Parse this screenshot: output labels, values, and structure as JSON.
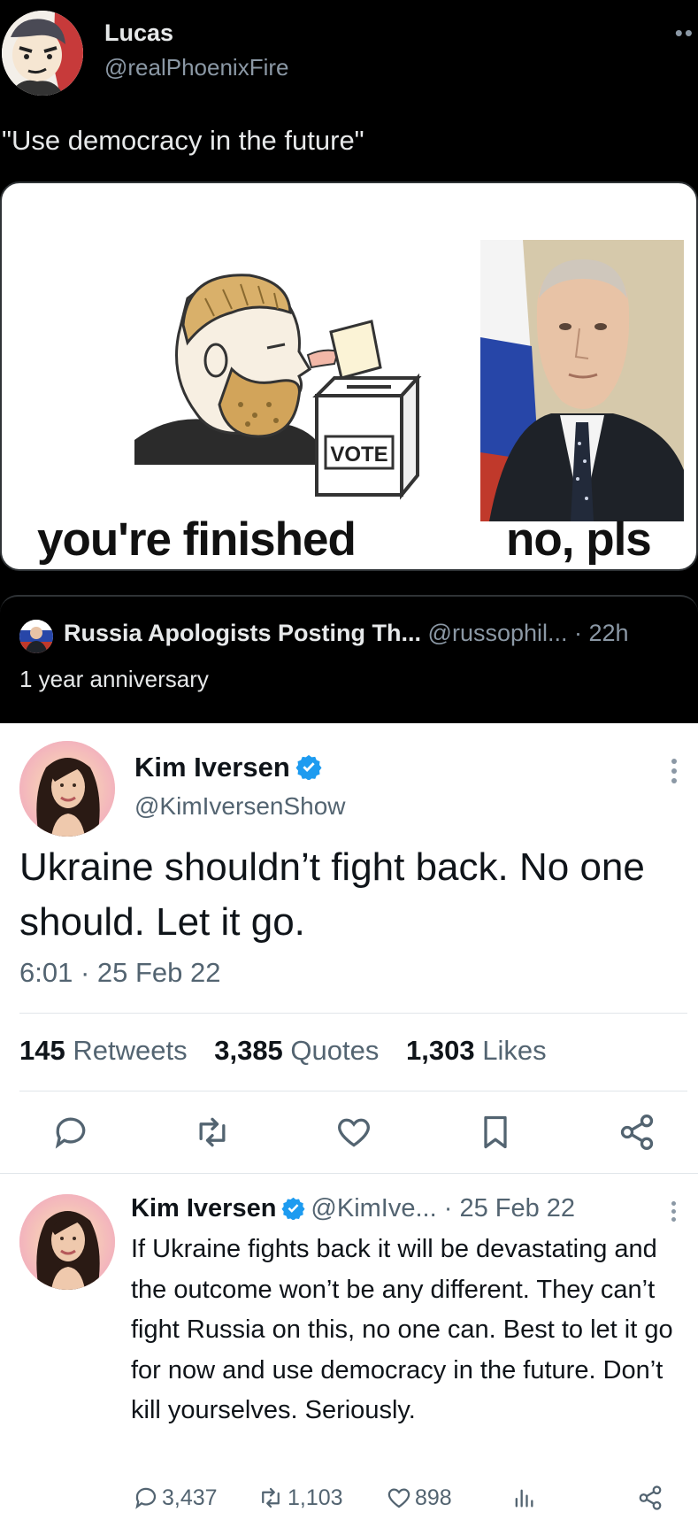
{
  "top_tweet": {
    "name": "Lucas",
    "handle": "@realPhoenixFire",
    "more": "••",
    "text": "\"Use democracy in the future\"",
    "meme": {
      "ballot_label": "VOTE",
      "caption_left": "you're finished",
      "caption_right": "no, pls"
    }
  },
  "quoted": {
    "name": "Russia Apologists Posting Th...",
    "handle": "@russophil...",
    "time": "· 22h",
    "text": "1 year anniversary"
  },
  "tweet1": {
    "name": "Kim Iversen",
    "handle": "@KimIversenShow",
    "text": "Ukraine shouldn’t fight back. No one should. Let it go.",
    "time": "6:01 · 25 Feb 22",
    "retweets_count": "145",
    "retweets_label": "Retweets",
    "quotes_count": "3,385",
    "quotes_label": "Quotes",
    "likes_count": "1,303",
    "likes_label": "Likes"
  },
  "tweet2": {
    "name": "Kim Iversen",
    "handle": "@KimIve...",
    "date": "· 25 Feb 22",
    "text": "If Ukraine fights back it will be devastating and the outcome won’t be any different. They can’t fight Russia on this, no one can. Best to let it go for now and use democracy in the future. Don’t kill yourselves. Seriously.",
    "replies": "3,437",
    "retweets": "1,103",
    "likes": "898"
  },
  "colors": {
    "verified": "#1d9bf0",
    "muted": "#536471",
    "dark_bg": "#000000"
  }
}
